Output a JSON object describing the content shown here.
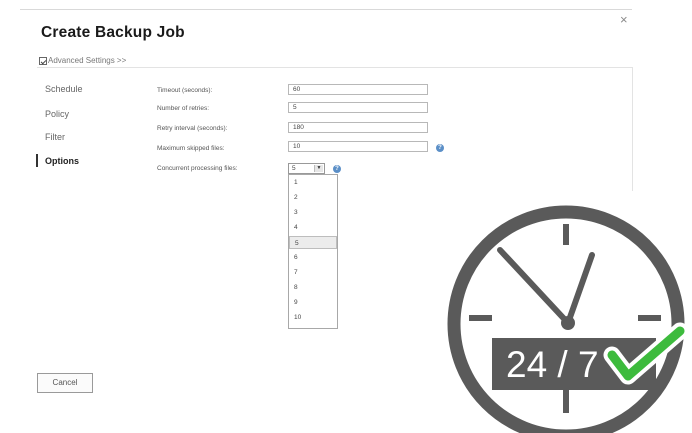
{
  "dialog": {
    "title": "Create Backup Job",
    "close_glyph": "×",
    "advanced_label": "Advanced Settings >>",
    "cancel_label": "Cancel"
  },
  "nav": {
    "items": [
      {
        "label": "Schedule"
      },
      {
        "label": "Policy"
      },
      {
        "label": "Filter"
      },
      {
        "label": "Options",
        "active": true
      }
    ]
  },
  "options": {
    "timeout": {
      "label": "Timeout (seconds):",
      "value": "60"
    },
    "retries": {
      "label": "Number of retries:",
      "value": "5"
    },
    "retry_interval": {
      "label": "Retry interval (seconds):",
      "value": "180"
    },
    "max_skipped": {
      "label": "Maximum skipped files:",
      "value": "10"
    },
    "concurrent": {
      "label": "Concurrent processing files:",
      "value": "5"
    }
  },
  "dropdown": {
    "options": [
      "1",
      "2",
      "3",
      "4",
      "5",
      "6",
      "7",
      "8",
      "9",
      "10"
    ],
    "highlighted": "5"
  },
  "badge": {
    "text": "24 / 7",
    "icon": "clock-icon",
    "check_icon": "checkmark-icon",
    "colors": {
      "dark": "#5a5a5a",
      "green": "#3dbb3d",
      "white": "#ffffff"
    }
  }
}
